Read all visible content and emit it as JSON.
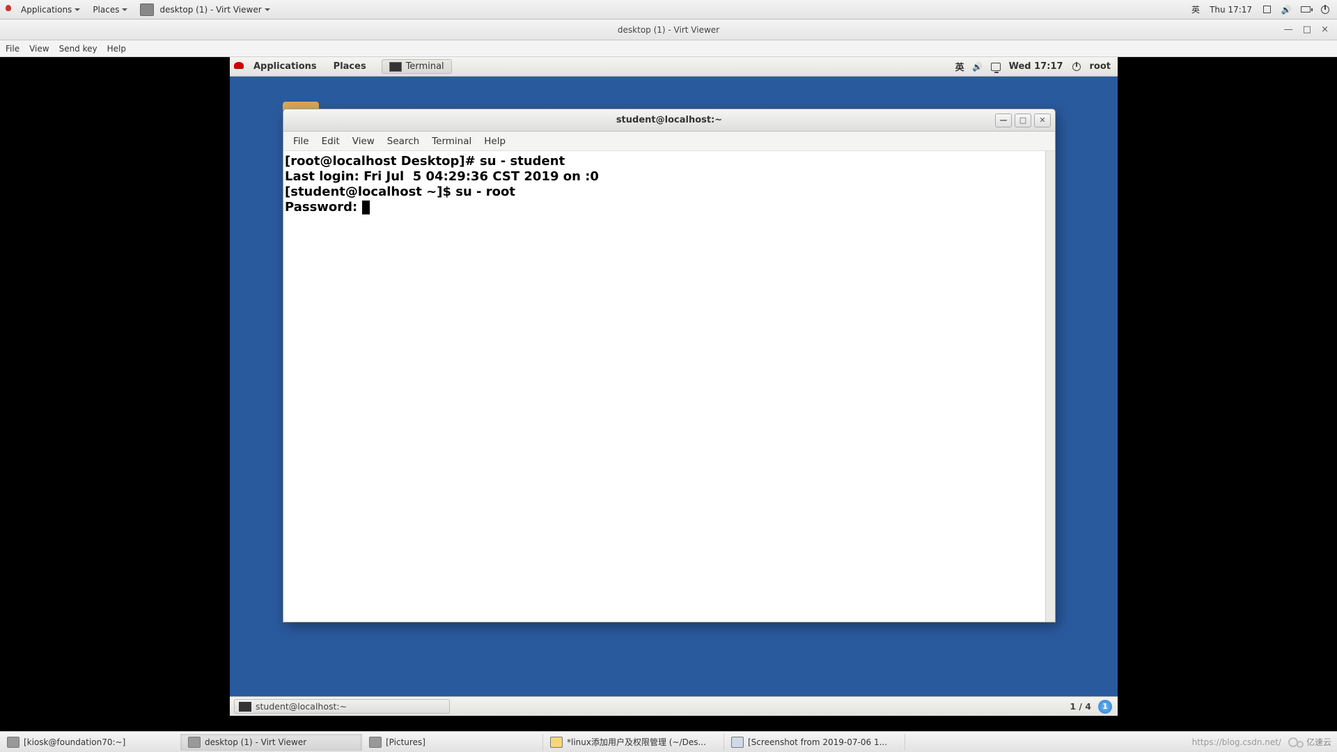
{
  "host_panel": {
    "applications": "Applications",
    "places": "Places",
    "task_title": "desktop (1) - Virt Viewer",
    "input_method": "英",
    "clock": "Thu 17:17"
  },
  "virt_viewer": {
    "title": "desktop (1) - Virt Viewer",
    "menu": {
      "file": "File",
      "view": "View",
      "sendkey": "Send key",
      "help": "Help"
    },
    "ctl": {
      "min": "—",
      "max": "□",
      "close": "×"
    }
  },
  "guest_panel": {
    "applications": "Applications",
    "places": "Places",
    "terminal_task": "Terminal",
    "input_method": "英",
    "clock": "Wed 17:17",
    "user": "root"
  },
  "terminal": {
    "title": "student@localhost:~",
    "menu": {
      "file": "File",
      "edit": "Edit",
      "view": "View",
      "search": "Search",
      "terminal": "Terminal",
      "help": "Help"
    },
    "lines": {
      "l1": "[root@localhost Desktop]# su - student",
      "l2": "Last login: Fri Jul  5 04:29:36 CST 2019 on :0",
      "l3": "[student@localhost ~]$ su - root",
      "l4": "Password: "
    },
    "wbtn": {
      "min": "—",
      "max": "□",
      "close": "✕"
    }
  },
  "guest_taskbar": {
    "item": "student@localhost:~",
    "workspace": "1 / 4",
    "ws_badge": "1"
  },
  "host_taskbar": {
    "items": [
      "[kiosk@foundation70:~]",
      "desktop (1) - Virt Viewer",
      "[Pictures]",
      "*linux添加用户及权限管理 (~/Des...",
      "[Screenshot from 2019-07-06 1..."
    ],
    "watermark": "https://blog.csdn.net/",
    "brand": "亿速云"
  }
}
